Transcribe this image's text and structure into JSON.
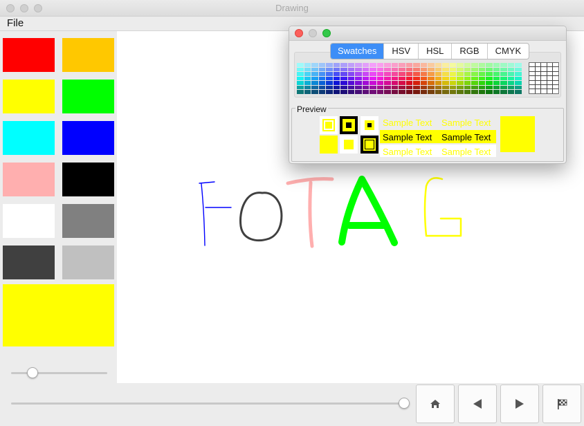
{
  "window": {
    "title": "Drawing"
  },
  "menu": {
    "file": "File"
  },
  "palette": {
    "colors": [
      "#ff0000",
      "#ffc800",
      "#ffff00",
      "#00ff00",
      "#00ffff",
      "#0000ff",
      "#ffafaf",
      "#000000",
      "#ffffff",
      "#808080",
      "#404040",
      "#c0c0c0"
    ],
    "current": "#ffff00",
    "brush_size": 0.22
  },
  "playback": {
    "position": 1.0
  },
  "canvas_strokes": [
    {
      "letter": "F",
      "color": "#0000ff"
    },
    {
      "letter": "O",
      "color": "#404040"
    },
    {
      "letter": "T",
      "color": "#ffafaf"
    },
    {
      "letter": "A",
      "color": "#00ff00"
    },
    {
      "letter": "G",
      "color": "#ffff00"
    }
  ],
  "nav_buttons": [
    "home-icon",
    "previous-icon",
    "next-icon",
    "finish-flag-icon"
  ],
  "color_chooser": {
    "tabs": [
      "Swatches",
      "HSV",
      "HSL",
      "RGB",
      "CMYK"
    ],
    "selected_tab": "Swatches",
    "preview_label": "Preview",
    "sample_text": "Sample Text",
    "selected_color": "#ffff00"
  }
}
